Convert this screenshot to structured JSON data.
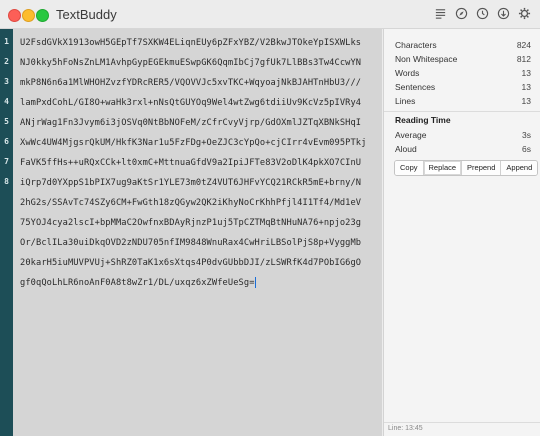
{
  "window": {
    "title": "TextBuddy"
  },
  "editor": {
    "line_numbers": [
      "1",
      "2",
      "3",
      "4",
      "5",
      "6",
      "7",
      "8"
    ],
    "lines": [
      "U2FsdGVkX1913owH5GEpTf7SXKW4ELiqnEUy6pZFxYBZ/V2BkwJTOkeYpISXWLks",
      "NJ0kky5hFoNsZnLM1AvhpGypEGEkmuESwpGK6QqmIbCj7gfUk7LlBBs3Tw4CcwYN",
      "mkP8N6n6a1MlWHOHZvzfYDRcRER5/VQOVVJc5xvTKC+WqyoajNkBJAHTnHbU3///",
      "lamPxdCohL/GI8O+waHk3rxl+nNsQtGUYOq9Wel4wtZwg6tdiiUv9KcVz5pIVRy4",
      "ANjrWag1Fn3Jvym6i3jOSVq0NtBbNOFeM/zCfrCvyVjrp/GdOXmlJZTqXBNkSHqI",
      "XwWc4UW4MjgsrQkUM/HkfK3Nar1u5FzFDg+OeZJC3cYpQo+cjCIrr4vEvm095PTkj",
      "FaVK5ffHs++uRQxCCk+lt0xmC+MttnuaGfdV9a2IpiJFTe83V2oDlK4pkXO7CInU",
      "iQrp7d0YXppS1bPIX7ug9aKtSr1YLE73m0tZ4VUT6JHFvYCQ21RCkR5mE+brny/N",
      "2hG2s/SSAvTc74SZy6CM+FwGth18zQGyw2QK2iKhyNoCrKhhPfjl4I1Tf4/Md1eV",
      "75YOJ4cya2lscI+bpMMaC2OwfnxBDAyRjnzP1uj5TpCZTMqBtNHuNA76+npjo23g",
      "Or/BclILa30uiDkqOVD2zNDU705nfIM9848WnuRax4CwHriLBSolPjS8p+VyggMb",
      "20karH5iuMUVPVUj+ShRZ0TaK1x6sXtqs4P0dvGUbbDJI/zLSWRfK4d7PObIG6gO",
      "gf0qQoLhLR6noAnF0A8t8wZr1/DL/uxqz6xZWfeUeSg="
    ]
  },
  "sidebar": {
    "stats": [
      {
        "label": "Characters",
        "value": "824"
      },
      {
        "label": "Non Whitespace",
        "value": "812"
      },
      {
        "label": "Words",
        "value": "13"
      },
      {
        "label": "Sentences",
        "value": "13"
      },
      {
        "label": "Lines",
        "value": "13"
      }
    ],
    "reading_time": {
      "title": "Reading Time",
      "rows": [
        {
          "label": "Average",
          "value": "3s"
        },
        {
          "label": "Aloud",
          "value": "6s"
        }
      ]
    },
    "buttons": [
      "Copy",
      "Replace",
      "Prepend",
      "Append"
    ],
    "status": "Line: 13:45"
  },
  "colors": {
    "gutter": "#1d4e57",
    "editor_bg": "#d5d5d5",
    "cursor": "#1a6ed8"
  },
  "icons": [
    "list-icon",
    "compass-icon",
    "clock-icon",
    "download-icon",
    "gear-icon"
  ]
}
